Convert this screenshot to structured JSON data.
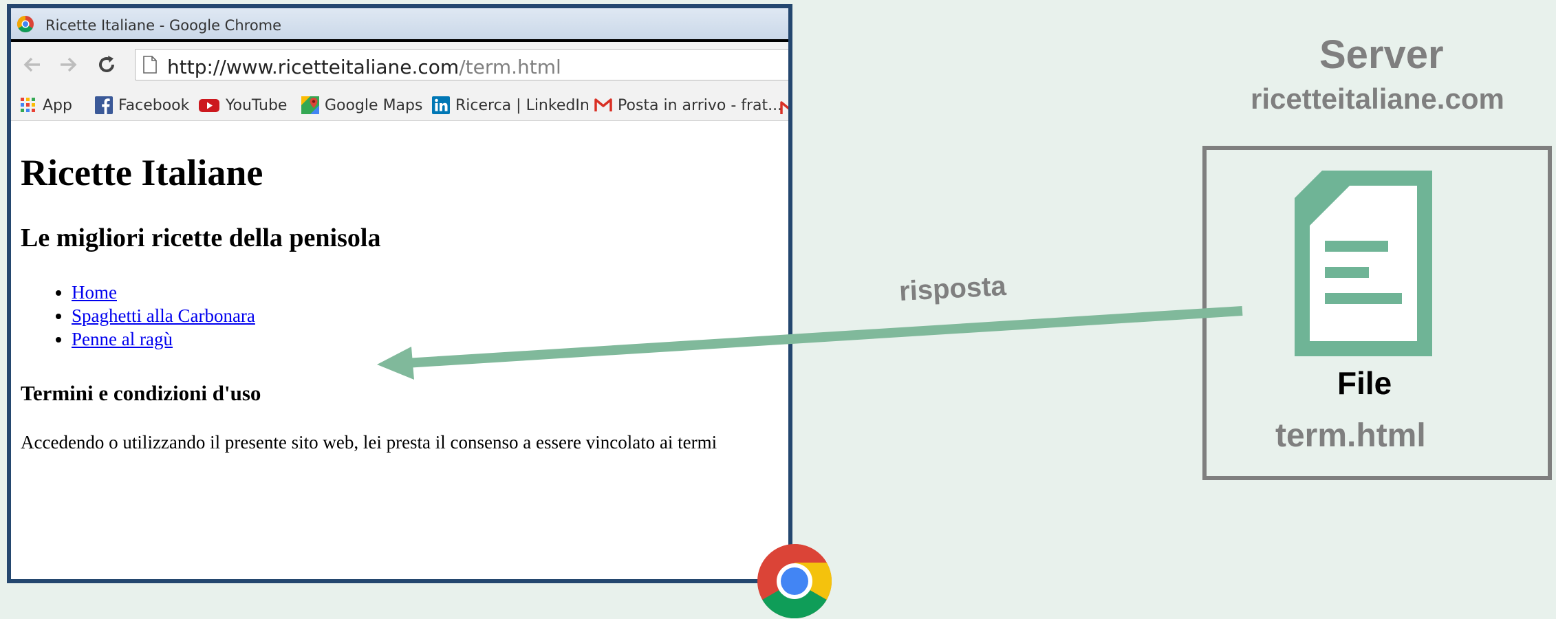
{
  "browser": {
    "window_title": "Ricette Italiane - Google Chrome",
    "url_host": "http://www.ricetteitaliane.com",
    "url_path": "/term.html",
    "bookmarks": [
      {
        "label": "App",
        "icon": "apps-grid-icon"
      },
      {
        "label": "Facebook",
        "icon": "facebook-icon"
      },
      {
        "label": "YouTube",
        "icon": "youtube-icon"
      },
      {
        "label": "Google Maps",
        "icon": "google-maps-icon"
      },
      {
        "label": "Ricerca | LinkedIn",
        "icon": "linkedin-icon"
      },
      {
        "label": "Posta in arrivo - frat...",
        "icon": "gmail-icon"
      }
    ]
  },
  "page": {
    "h1": "Ricette Italiane",
    "h2": "Le migliori ricette della penisola",
    "nav_links": [
      "Home",
      "Spaghetti alla Carbonara",
      "Penne al ragù"
    ],
    "h3": "Termini e condizioni d'uso",
    "paragraph": "Accedendo o utilizzando il presente sito web, lei presta il consenso a essere vincolato ai termi"
  },
  "server": {
    "title": "Server",
    "host": "ricetteitaliane.com",
    "file_label": "File",
    "file_name": "term.html"
  },
  "arrow": {
    "label": "risposta"
  },
  "colors": {
    "background": "#e8f1ec",
    "accent_green": "#6fb496",
    "arrow_green": "#80b99b",
    "window_border": "#24476f",
    "gray_text": "#7f7f7f"
  }
}
